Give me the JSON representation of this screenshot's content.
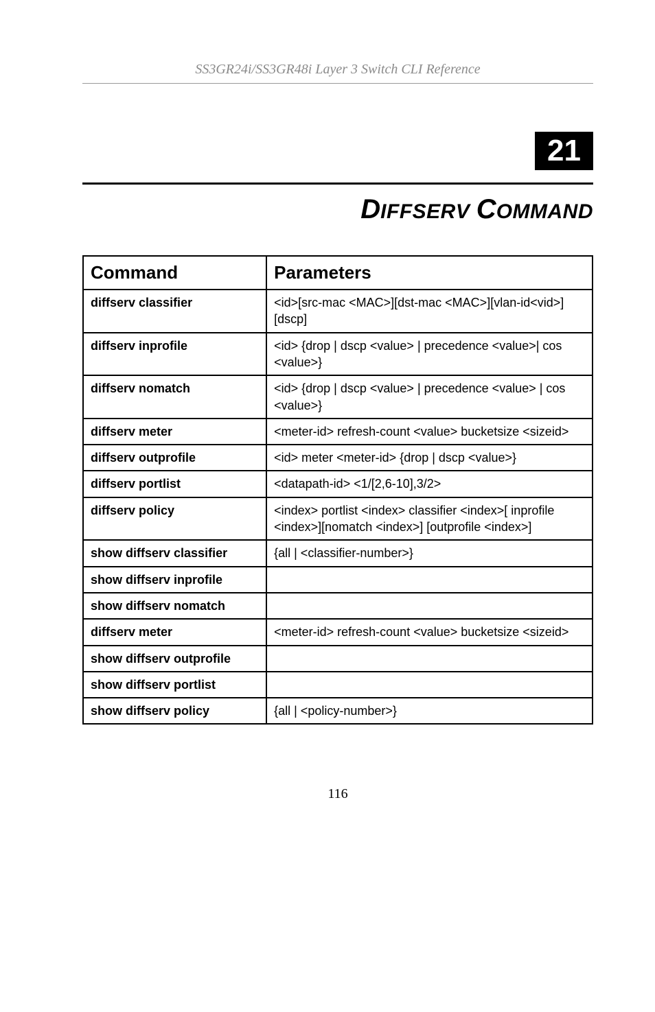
{
  "header": {
    "doc_title": "SS3GR24i/SS3GR48i Layer 3 Switch CLI Reference"
  },
  "chapter": {
    "number": "21",
    "title_1_big": "D",
    "title_1_small": "IFFSERV",
    "title_2_big": "C",
    "title_2_small": "OMMAND"
  },
  "table": {
    "headers": {
      "col1": "Command",
      "col2": "Parameters"
    },
    "rows": [
      {
        "cmd": "diffserv classifier",
        "params": "<id>[src-mac <MAC>][dst-mac <MAC>][vlan-id<vid>][dscp]"
      },
      {
        "cmd": "diffserv inprofile",
        "params": "<id> {drop | dscp <value> | precedence <value>| cos <value>}"
      },
      {
        "cmd": "diffserv nomatch",
        "params": "<id> {drop | dscp <value> | precedence <value> | cos <value>}"
      },
      {
        "cmd": "diffserv meter",
        "params": "<meter-id> refresh-count <value> bucketsize <sizeid>"
      },
      {
        "cmd": "diffserv outprofile",
        "params": "<id> meter <meter-id> {drop | dscp <value>}"
      },
      {
        "cmd": "diffserv portlist",
        "params": "<datapath-id> <1/[2,6-10],3/2>"
      },
      {
        "cmd": "diffserv policy",
        "params": "<index> portlist <index> classifier <index>[ inprofile <index>][nomatch <index>] [outprofile <index>]"
      },
      {
        "cmd": "show diffserv classifier",
        "params": "{all | <classifier-number>}"
      },
      {
        "cmd": "show diffserv inprofile",
        "params": ""
      },
      {
        "cmd": "show diffserv nomatch",
        "params": ""
      },
      {
        "cmd": "diffserv meter",
        "params": "<meter-id> refresh-count <value> bucketsize <sizeid>"
      },
      {
        "cmd": "show diffserv outprofile",
        "params": ""
      },
      {
        "cmd": "show diffserv portlist",
        "params": ""
      },
      {
        "cmd": "show diffserv policy",
        "params": "{all | <policy-number>}"
      }
    ]
  },
  "footer": {
    "page_number": "116"
  }
}
